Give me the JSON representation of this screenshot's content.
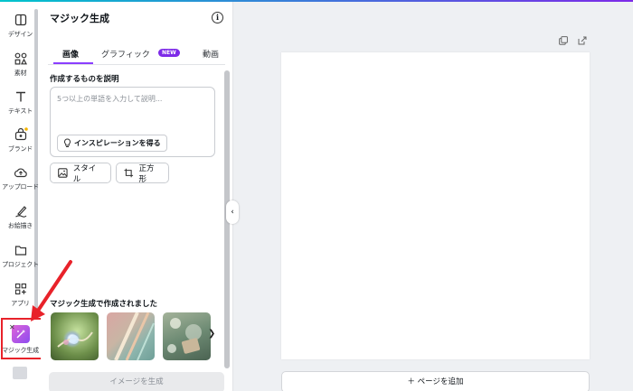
{
  "rail": {
    "items": [
      {
        "label": "デザイン",
        "icon": "design-icon"
      },
      {
        "label": "素材",
        "icon": "elements-icon"
      },
      {
        "label": "テキスト",
        "icon": "text-icon"
      },
      {
        "label": "ブランド",
        "icon": "brand-icon"
      },
      {
        "label": "アップロード",
        "icon": "upload-icon"
      },
      {
        "label": "お絵描き",
        "icon": "draw-icon"
      },
      {
        "label": "プロジェクト",
        "icon": "folder-icon"
      },
      {
        "label": "アプリ",
        "icon": "apps-icon"
      },
      {
        "label": "マジック生成",
        "icon": "magic-media-icon"
      }
    ]
  },
  "panel": {
    "title": "マジック生成",
    "tabs": [
      {
        "label": "画像",
        "active": true
      },
      {
        "label": "グラフィック",
        "badge": "NEW"
      },
      {
        "label": "動画"
      }
    ],
    "prompt_label": "作成するものを説明",
    "prompt_placeholder": "5つ以上の単語を入力して説明...",
    "inspire_label": "インスピレーションを得る",
    "style_label": "スタイル",
    "aspect_label": "正方形",
    "examples_label": "マジック生成で作成されました",
    "generate_label": "イメージを生成"
  },
  "canvas": {
    "add_page_label": "＋ ページを追加"
  },
  "colors": {
    "accent": "#8b3dff",
    "highlight": "#e8222a"
  }
}
